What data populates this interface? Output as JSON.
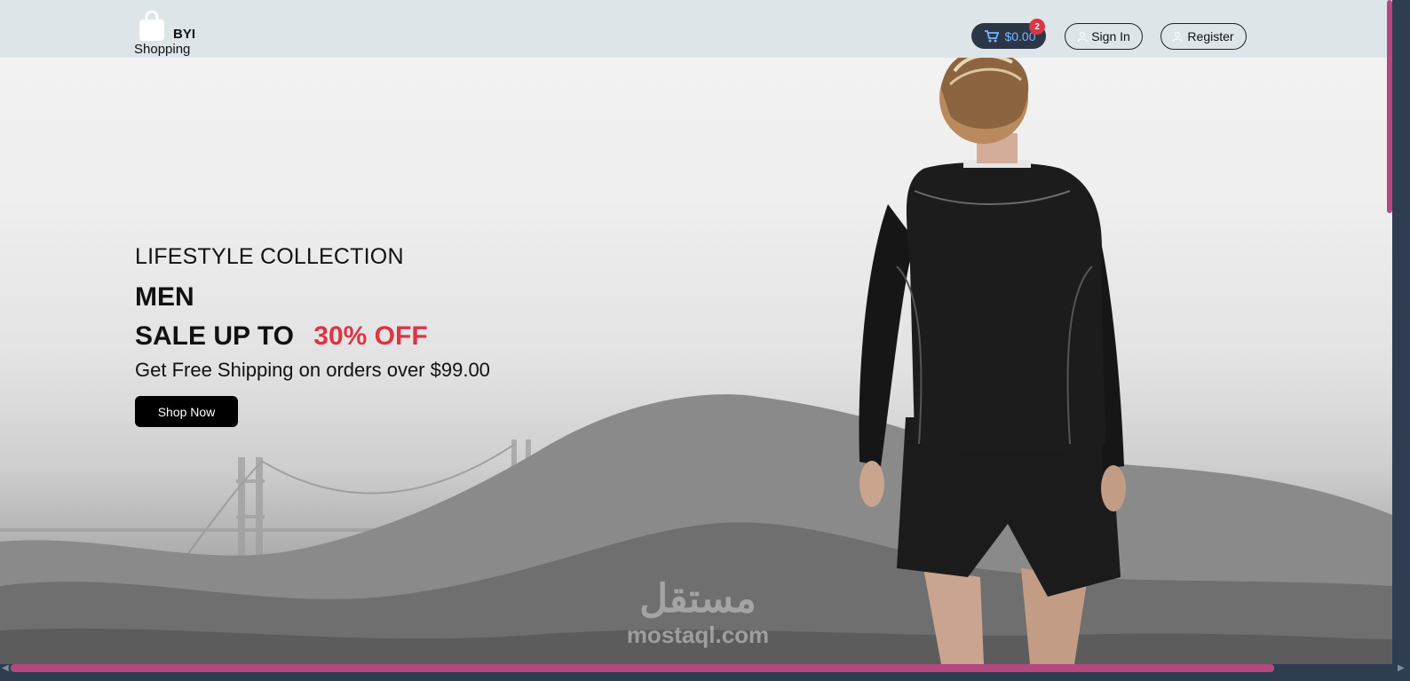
{
  "brand": {
    "name": "BYI",
    "subtitle": "Shopping"
  },
  "nav": {
    "cart_total": "$0.00",
    "cart_count": "2",
    "signin_label": "Sign In",
    "register_label": "Register"
  },
  "hero": {
    "collection": "LIFESTYLE COLLECTION",
    "category": "MEN",
    "sale_prefix": "SALE UP TO",
    "sale_highlight": "30% OFF",
    "shipping": "Get Free Shipping on orders over $99.00",
    "cta_label": "Shop Now"
  },
  "watermark": {
    "arabic": "مستقل",
    "domain": "mostaql.com"
  },
  "colors": {
    "accent": "#dc3545",
    "navbar": "#dde5e9",
    "cart_bg": "#2c3646",
    "scroll_thumb": "#b5487e"
  },
  "icons": {
    "logo": "shopping-bag-icon",
    "cart": "cart-icon",
    "signin": "user-icon",
    "register": "user-add-icon"
  }
}
